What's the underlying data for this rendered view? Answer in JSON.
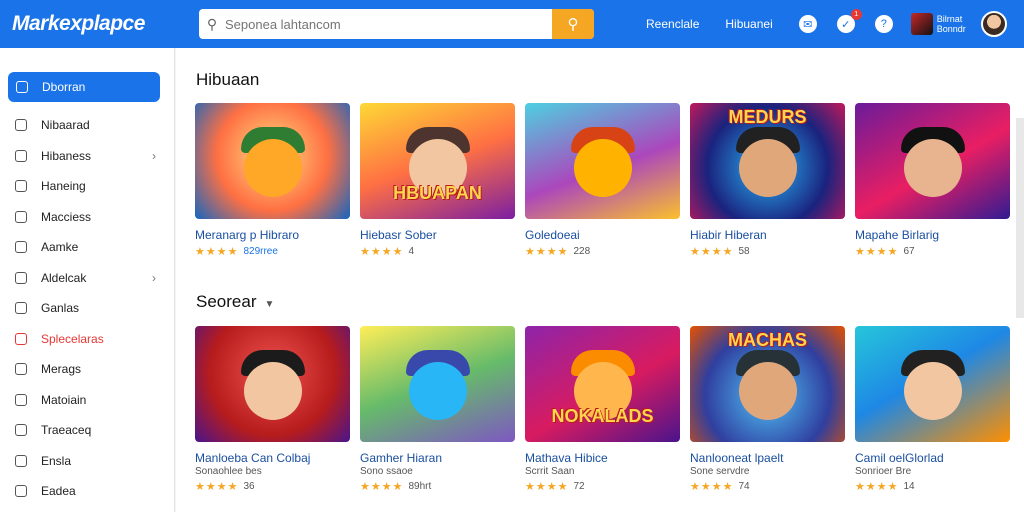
{
  "header": {
    "brand": "Markexplapce",
    "search_placeholder": "Seponea lahtancom",
    "nav_links": [
      "Reenclale",
      "Hibuanei"
    ],
    "user_name": "Bilrnat Bonndr",
    "notification_count": "1"
  },
  "sidebar": {
    "items": [
      {
        "label": "Dborran",
        "active": true
      },
      {
        "label": "Nibaarad"
      },
      {
        "label": "Hibaness",
        "chevron": true
      },
      {
        "label": "Haneing"
      },
      {
        "label": "Macciess"
      },
      {
        "label": "Aamke"
      },
      {
        "label": "Aldelcak",
        "chevron": true
      },
      {
        "label": "Ganlas"
      },
      {
        "label": "Splecelaras",
        "accent": true
      },
      {
        "label": "Merags"
      },
      {
        "label": "Matoiain"
      },
      {
        "label": "Traeaceq"
      },
      {
        "label": "Ensla"
      },
      {
        "label": "Eadea"
      }
    ]
  },
  "sections": [
    {
      "title": "Hibuaan",
      "cards": [
        {
          "title": "Meranarg p Hibraro",
          "rating": 4,
          "count": "829rree"
        },
        {
          "title": "Hiebasr Sober",
          "rating": 4,
          "count": "4",
          "word": "HBUAPAN"
        },
        {
          "title": "Goledoeai",
          "rating": 4,
          "count": "228"
        },
        {
          "title": "Hiabir Hiberan",
          "rating": 4,
          "count": "58",
          "word": "MEDURS"
        },
        {
          "title": "Mapahe Birlarig",
          "rating": 4,
          "count": "67"
        }
      ]
    },
    {
      "title": "Seorear",
      "cards": [
        {
          "title": "Manloeba Can Colbaj",
          "subtitle": "Sonaohlee bes",
          "rating": 4,
          "count": "36"
        },
        {
          "title": "Gamher Hiaran",
          "subtitle": "Sono ssaoe",
          "rating": 4,
          "count": "89hrt"
        },
        {
          "title": "Mathava Hibice",
          "subtitle": "Scrrit Saan",
          "rating": 4,
          "count": "72",
          "word": "NOKALADS"
        },
        {
          "title": "Nanlooneat lpaelt",
          "subtitle": "Sone servdre",
          "rating": 4,
          "count": "74",
          "word": "MACHAS"
        },
        {
          "title": "Camil oelGlorlad",
          "subtitle": "Sonrioer Bre",
          "rating": 4,
          "count": "14"
        }
      ]
    }
  ],
  "colors": {
    "primary": "#1a73e8",
    "accent": "#f5a623",
    "danger": "#e53935"
  }
}
